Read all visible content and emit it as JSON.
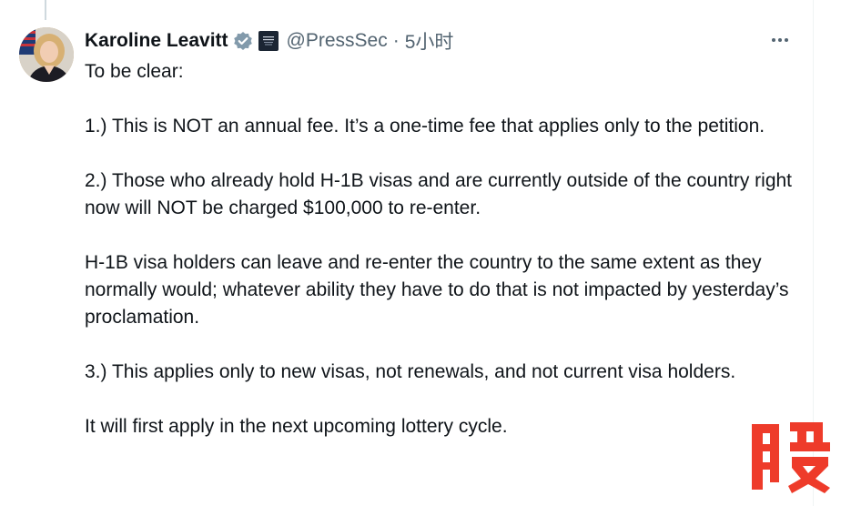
{
  "tweet": {
    "author": {
      "display_name": "Karoline Leavitt",
      "handle": "@PressSec",
      "verified": true,
      "verified_color": "#829aab",
      "avatar_icon": "profile-photo",
      "affiliation_icon": "white-house-seal-badge"
    },
    "separator": "·",
    "timestamp": "5小时",
    "more_icon": "more-horizontal-icon",
    "text": "To be clear:\n\n1.) This is NOT an annual fee. It’s a one-time fee that applies only to the petition.\n\n2.) Those who already hold H-1B visas and are currently outside of the country right now will NOT be charged $100,000 to re-enter.\n\nH-1B visa holders can leave and re-enter the country to the same extent as they normally would; whatever ability they have to do that is not impacted by yesterday’s proclamation.\n\n3.) This applies only to new visas, not renewals, and not current visa holders.\n\nIt will first apply in the next upcoming lottery cycle."
  },
  "watermark": {
    "text": "股",
    "color": "#ee3b2a"
  },
  "colors": {
    "text_primary": "#0f1419",
    "text_secondary": "#536471",
    "thread_line": "#cfd9de"
  }
}
